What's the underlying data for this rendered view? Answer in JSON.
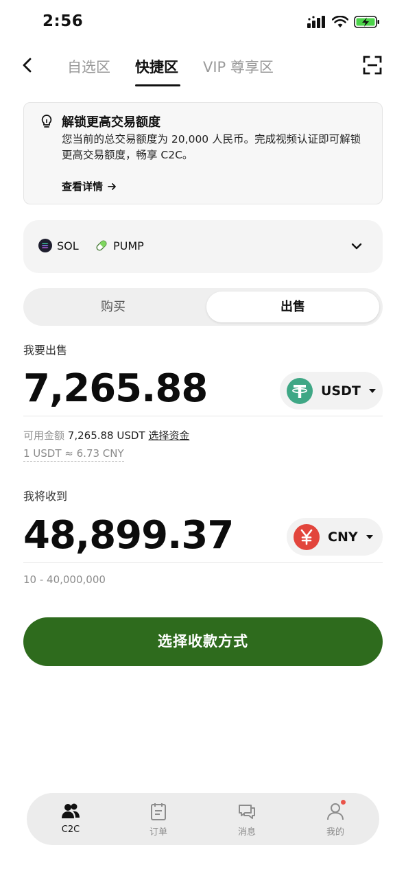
{
  "status_bar": {
    "time": "2:56"
  },
  "nav": {
    "tabs": [
      "自选区",
      "快捷区",
      "VIP 尊享区"
    ],
    "active_tab": "快捷区"
  },
  "notice": {
    "title": "解锁更高交易额度",
    "body": "您当前的总交易额度为 20,000 人民币。完成视频认证即可解锁更高交易额度，畅享 C2C。",
    "link_label": "查看详情"
  },
  "network_selector": {
    "items": [
      {
        "label": "SOL",
        "icon": "solana-icon"
      },
      {
        "label": "PUMP",
        "icon": "pill-icon"
      }
    ]
  },
  "trade_toggle": {
    "buy_label": "购买",
    "sell_label": "出售",
    "selected": "出售"
  },
  "sell_section": {
    "label": "我要出售",
    "amount": "7,265.88",
    "currency": "USDT",
    "available_prefix": "可用金额",
    "available_value": "7,265.88 USDT",
    "select_funds_label": "选择资金",
    "rate": "1 USDT ≈ 6.73 CNY"
  },
  "receive_section": {
    "label": "我将收到",
    "amount": "48,899.37",
    "currency": "CNY",
    "range": "10 - 40,000,000"
  },
  "cta": {
    "label": "选择收款方式"
  },
  "bottom_tabs": [
    {
      "label": "C2C",
      "icon": "users-icon",
      "active": true
    },
    {
      "label": "订单",
      "icon": "order-icon",
      "active": false
    },
    {
      "label": "消息",
      "icon": "message-icon",
      "active": false
    },
    {
      "label": "我的",
      "icon": "profile-icon",
      "active": false,
      "badge": true
    }
  ],
  "colors": {
    "primary_green": "#2e6b1d",
    "usdt_green": "#3fa785",
    "cny_red": "#e2453c",
    "badge_red": "#e9544a"
  }
}
